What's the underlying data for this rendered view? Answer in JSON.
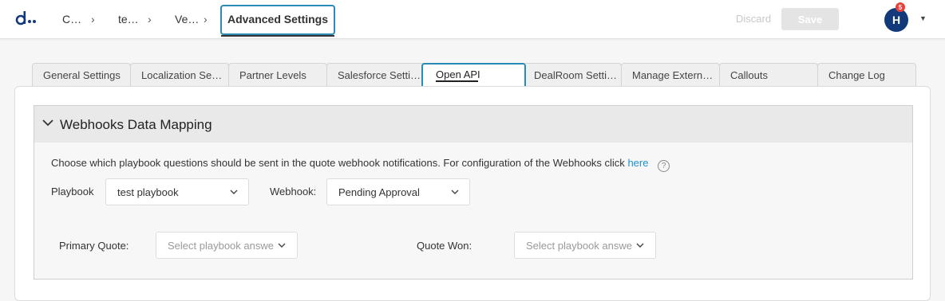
{
  "header": {
    "breadcrumbs": [
      "C…",
      "te…",
      "Ve…"
    ],
    "current": "Advanced Settings",
    "discard_label": "Discard",
    "save_label": "Save",
    "avatar_initial": "H",
    "notification_count": "5"
  },
  "tabs": [
    {
      "label": "General Settings"
    },
    {
      "label": "Localization Se…"
    },
    {
      "label": "Partner Levels"
    },
    {
      "label": "Salesforce Setti…"
    },
    {
      "label": "Open API",
      "active": true
    },
    {
      "label": "DealRoom Setti…"
    },
    {
      "label": "Manage Extern…"
    },
    {
      "label": "Callouts"
    },
    {
      "label": "Change Log"
    }
  ],
  "section": {
    "title": "Webhooks Data Mapping",
    "description": "Choose which playbook questions should be sent in the quote webhook notifications. For configuration of the Webhooks click",
    "link": "here",
    "playbook_label": "Playbook",
    "playbook_value": "test playbook",
    "webhook_label": "Webhook:",
    "webhook_value": "Pending Approval",
    "primary_quote_label": "Primary Quote:",
    "primary_quote_placeholder": "Select playbook answe",
    "quote_won_label": "Quote Won:",
    "quote_won_placeholder": "Select playbook answe"
  },
  "colors": {
    "accent": "#2a8ab3",
    "link": "#1e8fd0",
    "avatar": "#123a7a",
    "badge": "#e5423b"
  }
}
